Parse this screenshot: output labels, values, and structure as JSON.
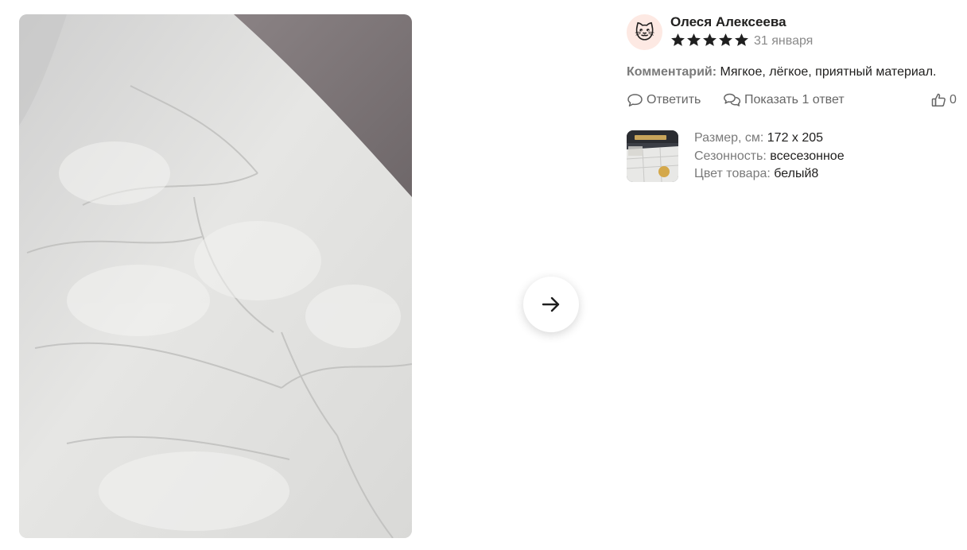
{
  "review": {
    "author_name": "Олеся Алексеева",
    "avatar_emoji": "🐱",
    "rating": 5,
    "rating_max": 5,
    "date": "31 января",
    "comment_label": "Комментарий:",
    "comment_text": "Мягкое, лёгкое, приятный материал."
  },
  "actions": {
    "reply_label": "Ответить",
    "show_replies_label": "Показать 1 ответ",
    "likes_count": "0"
  },
  "product": {
    "size_label": "Размер, см:",
    "size_value": "172 x 205",
    "season_label": "Сезонность:",
    "season_value": "всесезонное",
    "color_label": "Цвет товара:",
    "color_value": "белый8"
  },
  "icons": {
    "next": "arrow-right-icon",
    "reply": "speech-bubble-icon",
    "replies": "two-speech-bubbles-icon",
    "like": "thumbs-up-icon",
    "star": "star-icon"
  },
  "colors": {
    "star": "#1f1f1f",
    "muted_text": "#7a7a7a",
    "avatar_bg": "#fde9e3"
  }
}
